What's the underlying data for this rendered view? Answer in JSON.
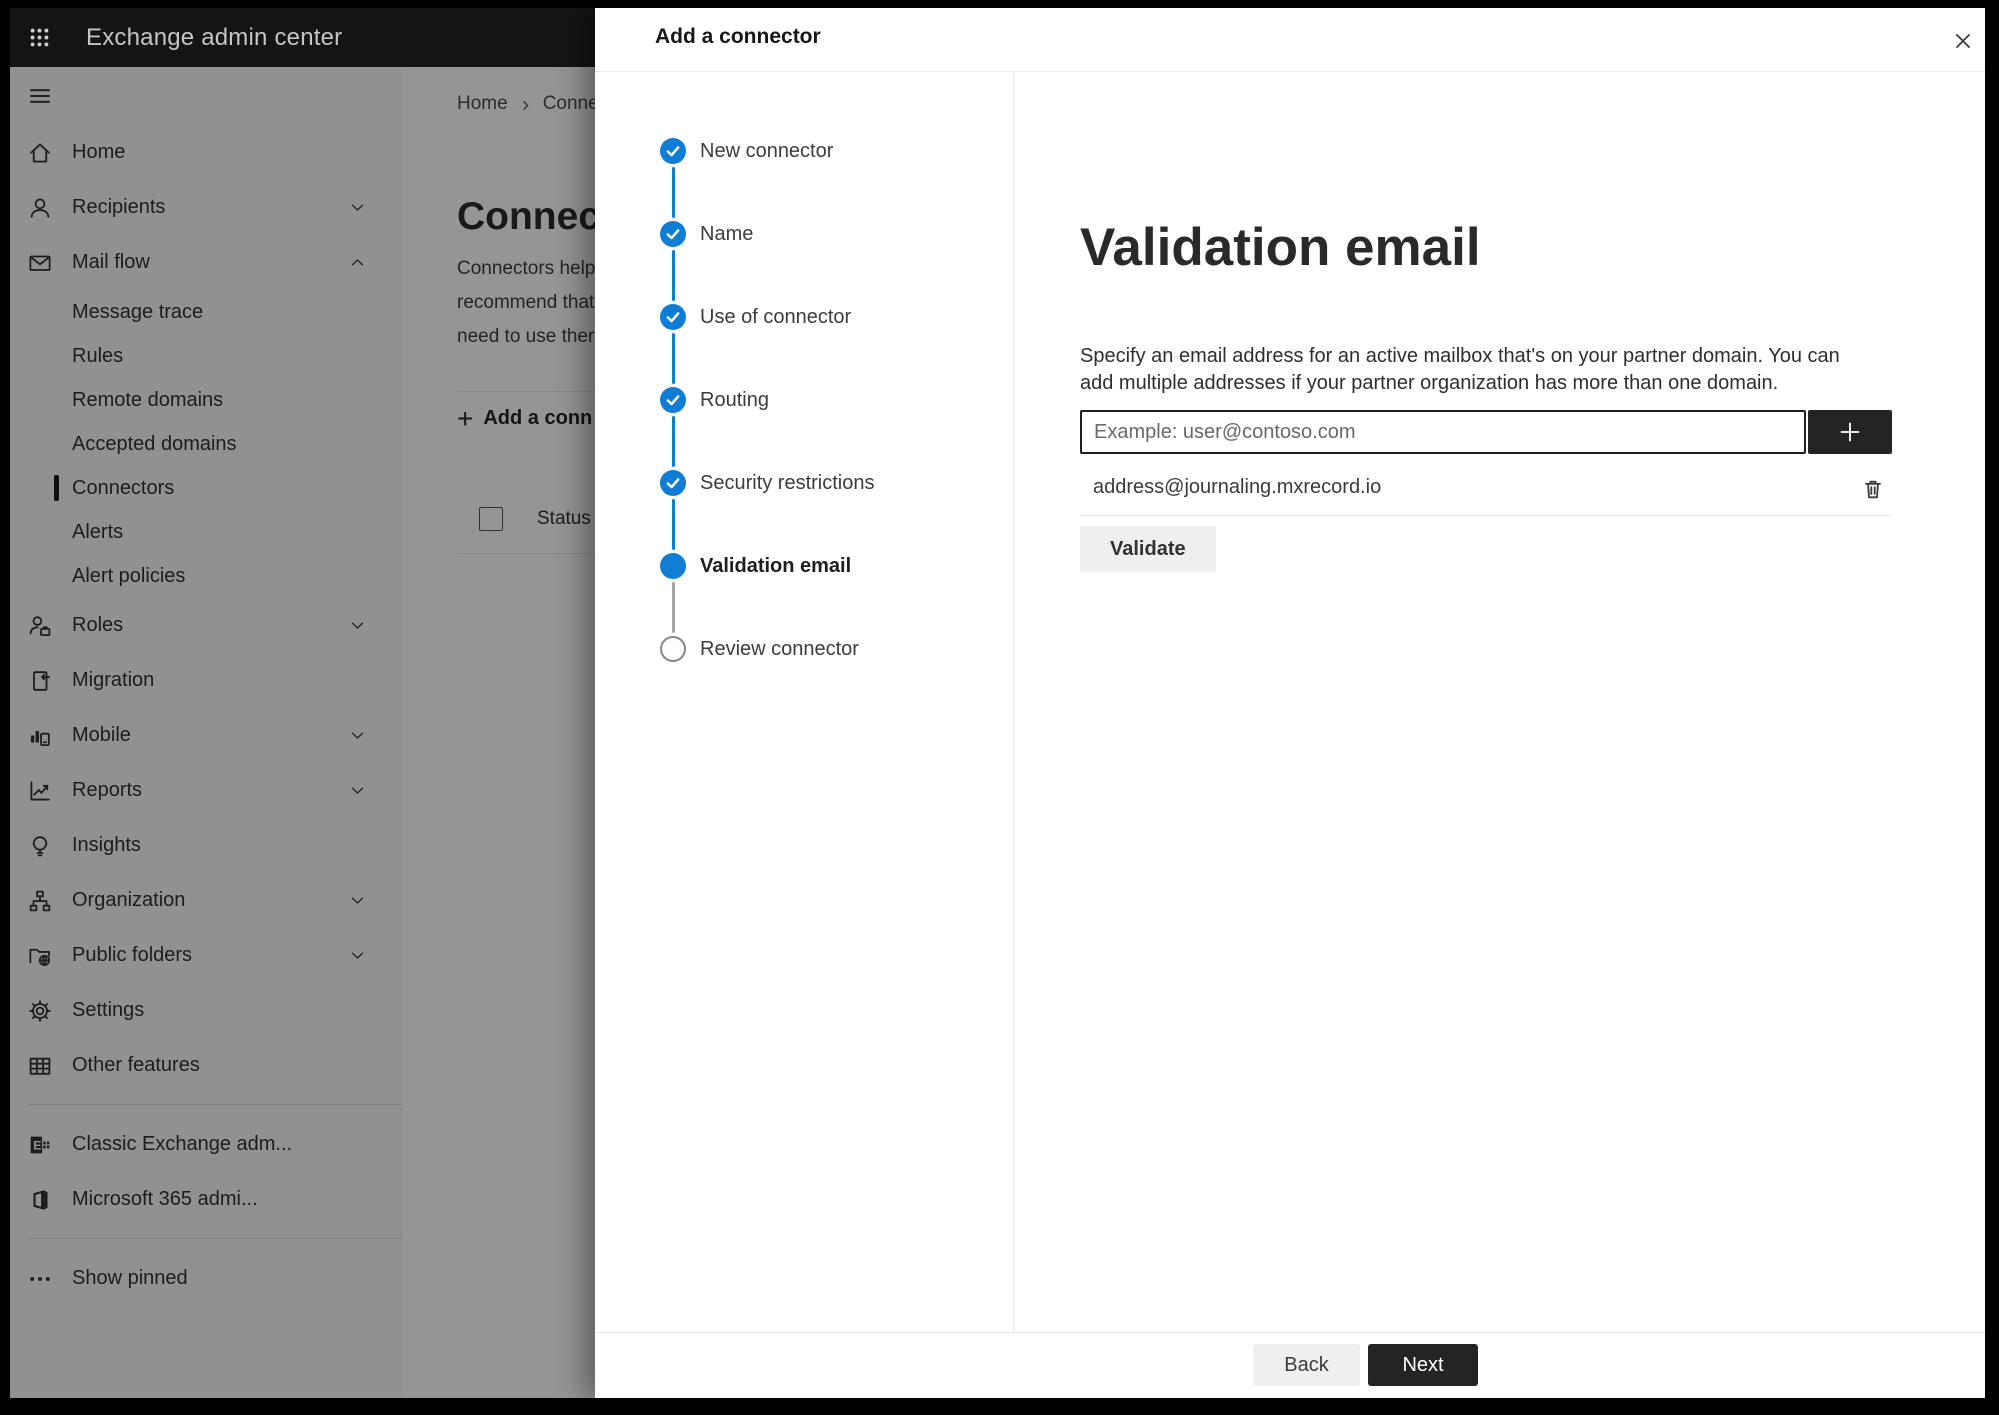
{
  "colors": {
    "accent": "#0f7dd3",
    "topbar_bg": "#141414",
    "frame": "#000000",
    "dark_button": "#242424"
  },
  "app": {
    "title": "Exchange admin center"
  },
  "sidebar": {
    "items": [
      {
        "label": "Home",
        "icon": "home",
        "type": "main"
      },
      {
        "label": "Recipients",
        "icon": "person",
        "type": "main",
        "chevron": "down"
      },
      {
        "label": "Mail flow",
        "icon": "mail",
        "type": "main",
        "chevron": "up"
      },
      {
        "label": "Message trace",
        "type": "sub"
      },
      {
        "label": "Rules",
        "type": "sub"
      },
      {
        "label": "Remote domains",
        "type": "sub"
      },
      {
        "label": "Accepted domains",
        "type": "sub"
      },
      {
        "label": "Connectors",
        "type": "sub",
        "selected": true
      },
      {
        "label": "Alerts",
        "type": "sub"
      },
      {
        "label": "Alert policies",
        "type": "sub"
      },
      {
        "label": "Roles",
        "icon": "roles",
        "type": "main",
        "chevron": "down"
      },
      {
        "label": "Migration",
        "icon": "migration",
        "type": "main"
      },
      {
        "label": "Mobile",
        "icon": "mobile",
        "type": "main",
        "chevron": "down"
      },
      {
        "label": "Reports",
        "icon": "reports",
        "type": "main",
        "chevron": "down"
      },
      {
        "label": "Insights",
        "icon": "insights",
        "type": "main"
      },
      {
        "label": "Organization",
        "icon": "organization",
        "type": "main",
        "chevron": "down"
      },
      {
        "label": "Public folders",
        "icon": "public-folders",
        "type": "main",
        "chevron": "down"
      },
      {
        "label": "Settings",
        "icon": "settings",
        "type": "main"
      },
      {
        "label": "Other features",
        "icon": "other-features",
        "type": "main"
      },
      {
        "type": "divider"
      },
      {
        "label": "Classic Exchange adm...",
        "icon": "classic-exchange",
        "type": "main"
      },
      {
        "label": "Microsoft 365 admi...",
        "icon": "m365",
        "type": "main"
      },
      {
        "type": "divider"
      },
      {
        "label": "Show pinned",
        "icon": "ellipsis",
        "type": "main"
      }
    ]
  },
  "page": {
    "breadcrumb": {
      "home": "Home",
      "current": "Conne"
    },
    "title": "Connec",
    "description_lines": {
      "0": "Connectors help",
      "1": "recommend that",
      "2": "need to use ther"
    },
    "add_button": "Add a conn",
    "table": {
      "status_header": "Status"
    }
  },
  "panel": {
    "title": "Add a connector",
    "steps": [
      {
        "label": "New connector",
        "state": "complete"
      },
      {
        "label": "Name",
        "state": "complete"
      },
      {
        "label": "Use of connector",
        "state": "complete"
      },
      {
        "label": "Routing",
        "state": "complete"
      },
      {
        "label": "Security restrictions",
        "state": "complete"
      },
      {
        "label": "Validation email",
        "state": "current"
      },
      {
        "label": "Review connector",
        "state": "upcoming"
      }
    ],
    "content": {
      "heading": "Validation email",
      "description": "Specify an email address for an active mailbox that's on your partner domain. You can add multiple addresses if your partner organization has more than one domain.",
      "input_placeholder": "Example: user@contoso.com",
      "addresses": [
        "address@journaling.mxrecord.io"
      ],
      "validate_button": "Validate"
    },
    "footer": {
      "back": "Back",
      "next": "Next"
    }
  }
}
